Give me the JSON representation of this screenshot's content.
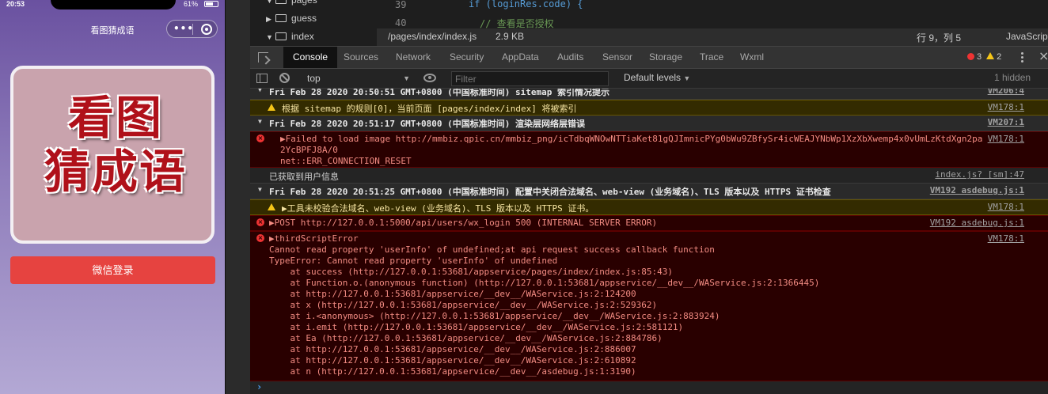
{
  "phone": {
    "status_time": "20:53",
    "battery": "61%",
    "nav_title": "看图猜成语",
    "logo_line1": "看图",
    "logo_line2": "猜成语",
    "login_button": "微信登录"
  },
  "editor": {
    "tree": [
      {
        "label": "pages",
        "expanded": true
      },
      {
        "label": "guess",
        "expanded": false
      },
      {
        "label": "index",
        "expanded": true
      }
    ],
    "lines": [
      {
        "no": "39",
        "code": "if (loginRes.code) {"
      },
      {
        "no": "40",
        "code": "// 查看是否授权"
      }
    ],
    "file_path": "/pages/index/index.js",
    "file_size": "2.9 KB",
    "cursor": "行 9，列 5",
    "language": "JavaScript"
  },
  "devtools": {
    "tabs": [
      "Console",
      "Sources",
      "Network",
      "Security",
      "AppData",
      "Audits",
      "Sensor",
      "Storage",
      "Trace",
      "Wxml"
    ],
    "active_tab": "Console",
    "error_count": "3",
    "warning_count": "2"
  },
  "toolbar": {
    "context": "top",
    "filter_placeholder": "Filter",
    "levels": "Default levels",
    "hidden": "1 hidden"
  },
  "console": {
    "entries": [
      {
        "kind": "group",
        "text": "Fri Feb 28 2020 20:50:51 GMT+0800 (中国标准时间) sitemap 索引情况提示",
        "source": "VM206:4"
      },
      {
        "kind": "warn",
        "text": "根据 sitemap 的规则[0]，当前页面 [pages/index/index] 将被索引",
        "source": "VM178:1"
      },
      {
        "kind": "group",
        "text": "Fri Feb 28 2020 20:51:17 GMT+0800 (中国标准时间) 渲染层网络层错误",
        "source": "VM207:1"
      },
      {
        "kind": "error",
        "text": "▶Failed to load image http://mmbiz.qpic.cn/mmbiz_png/icTdbqWNOwNTTiaKet81gQJImnicPYg0bWu9ZBfySr4icWEAJYNbWp1XzXbXwemp4x0vUmLzKtdXgn2pa\n2YcBPFJ8A/0\nnet::ERR_CONNECTION_RESET",
        "source": "VM178:1"
      },
      {
        "kind": "info",
        "text": "已获取到用户信息",
        "source": "index.js? [sm]:47"
      },
      {
        "kind": "group",
        "text": "Fri Feb 28 2020 20:51:25 GMT+0800 (中国标准时间) 配置中关闭合法域名、web-view (业务域名)、TLS 版本以及 HTTPS 证书检查",
        "source": "VM192 asdebug.js:1"
      },
      {
        "kind": "warn",
        "text": "▶工具未校验合法域名、web-view (业务域名)、TLS 版本以及 HTTPS 证书。",
        "source": "VM178:1"
      },
      {
        "kind": "error",
        "text": "▶POST http://127.0.0.1:5000/api/users/wx_login 500 (INTERNAL SERVER ERROR)",
        "source": "VM192 asdebug.js:1"
      },
      {
        "kind": "error",
        "text": "▶thirdScriptError\nCannot read property 'userInfo' of undefined;at api request success callback function\nTypeError: Cannot read property 'userInfo' of undefined\n    at success (http://127.0.0.1:53681/appservice/pages/index/index.js:85:43)\n    at Function.o.(anonymous function) (http://127.0.0.1:53681/appservice/__dev__/WAService.js:2:1366445)\n    at http://127.0.0.1:53681/appservice/__dev__/WAService.js:2:124200\n    at x (http://127.0.0.1:53681/appservice/__dev__/WAService.js:2:529362)\n    at i.<anonymous> (http://127.0.0.1:53681/appservice/__dev__/WAService.js:2:883924)\n    at i.emit (http://127.0.0.1:53681/appservice/__dev__/WAService.js:2:581121)\n    at Ea (http://127.0.0.1:53681/appservice/__dev__/WAService.js:2:884786)\n    at http://127.0.0.1:53681/appservice/__dev__/WAService.js:2:886007\n    at http://127.0.0.1:53681/appservice/__dev__/WAService.js:2:610892\n    at n (http://127.0.0.1:53681/appservice/__dev__/asdebug.js:1:3190)",
        "source": "VM178:1"
      }
    ],
    "prompt": "›"
  }
}
